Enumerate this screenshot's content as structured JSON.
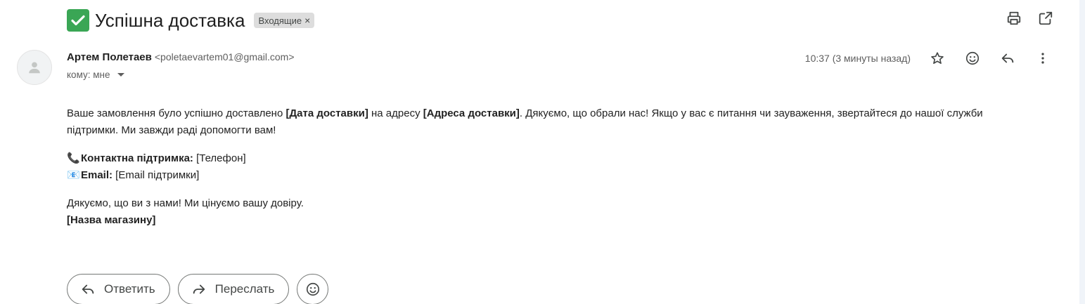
{
  "subject": {
    "emoji": "check-mark-icon",
    "title": "Успішна доставка",
    "label": "Входящие",
    "label_close": "×"
  },
  "top_actions": {
    "print_icon": "print-icon",
    "open_new_window_icon": "open-in-new-icon"
  },
  "sender": {
    "name": "Артем Полетаев",
    "email": "<poletaevartem01@gmail.com>",
    "to": "кому: мне",
    "time": "10:37 (3 минуты назад)"
  },
  "message_actions": {
    "star_icon": "star-icon",
    "emoji_icon": "emoji-reaction-icon",
    "reply_icon": "reply-icon",
    "more_icon": "more-vert-icon"
  },
  "body": {
    "p1_a": "Ваше замовлення було успішно доставлено ",
    "p1_b": "[Дата доставки]",
    "p1_c": " на адресу ",
    "p1_d": "[Адреса доставки]",
    "p1_e": ". Дякуємо, що обрали нас! Якщо у вас є питання чи зауваження, звертайтеся до нашої служби підтримки. Ми завжди раді допомогти вам!",
    "phone_emoji": "📞",
    "phone_label": "Контактна підтримка:",
    "phone_value": " [Телефон]",
    "email_emoji": "📧",
    "email_label": "Email:",
    "email_value": " [Email підтримки]",
    "thanks": "Дякуємо, що ви з нами! Ми цінуємо вашу довіру.",
    "store": "[Назва магазину]"
  },
  "footer_actions": {
    "reply_label": "Ответить",
    "forward_label": "Переслать"
  },
  "colors": {
    "check_green": "#3aa655",
    "chip_bg": "#dddddd",
    "border": "#747775"
  }
}
